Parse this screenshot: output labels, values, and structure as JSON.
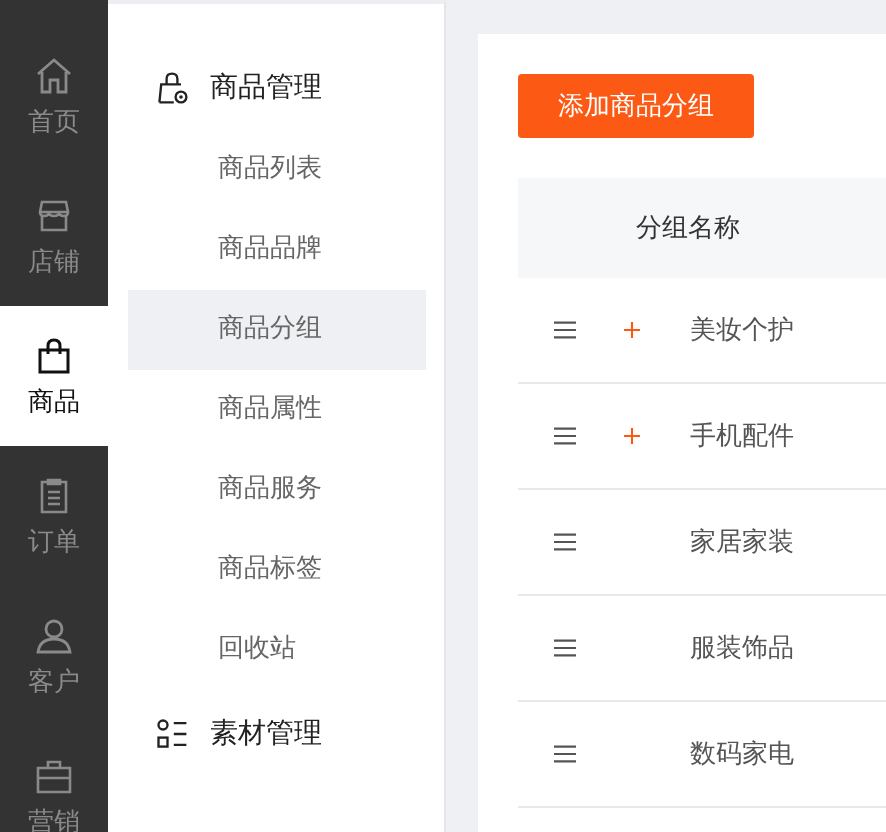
{
  "nav_rail": [
    {
      "label": "首页",
      "selected": false
    },
    {
      "label": "店铺",
      "selected": false
    },
    {
      "label": "商品",
      "selected": true
    },
    {
      "label": "订单",
      "selected": false
    },
    {
      "label": "客户",
      "selected": false
    },
    {
      "label": "营销",
      "selected": false
    }
  ],
  "submenu": [
    {
      "title": "商品管理",
      "items": [
        {
          "label": "商品列表",
          "selected": false
        },
        {
          "label": "商品品牌",
          "selected": false
        },
        {
          "label": "商品分组",
          "selected": true
        },
        {
          "label": "商品属性",
          "selected": false
        },
        {
          "label": "商品服务",
          "selected": false
        },
        {
          "label": "商品标签",
          "selected": false
        },
        {
          "label": "回收站",
          "selected": false
        }
      ]
    },
    {
      "title": "素材管理"
    }
  ],
  "add_button": "添加商品分组",
  "table": {
    "columns": [
      "分组名称"
    ],
    "rows": [
      {
        "name": "美妆个护",
        "expandable": true
      },
      {
        "name": "手机配件",
        "expandable": true
      },
      {
        "name": "家居家装",
        "expandable": false
      },
      {
        "name": "服装饰品",
        "expandable": false
      },
      {
        "name": "数码家电",
        "expandable": false
      }
    ]
  }
}
